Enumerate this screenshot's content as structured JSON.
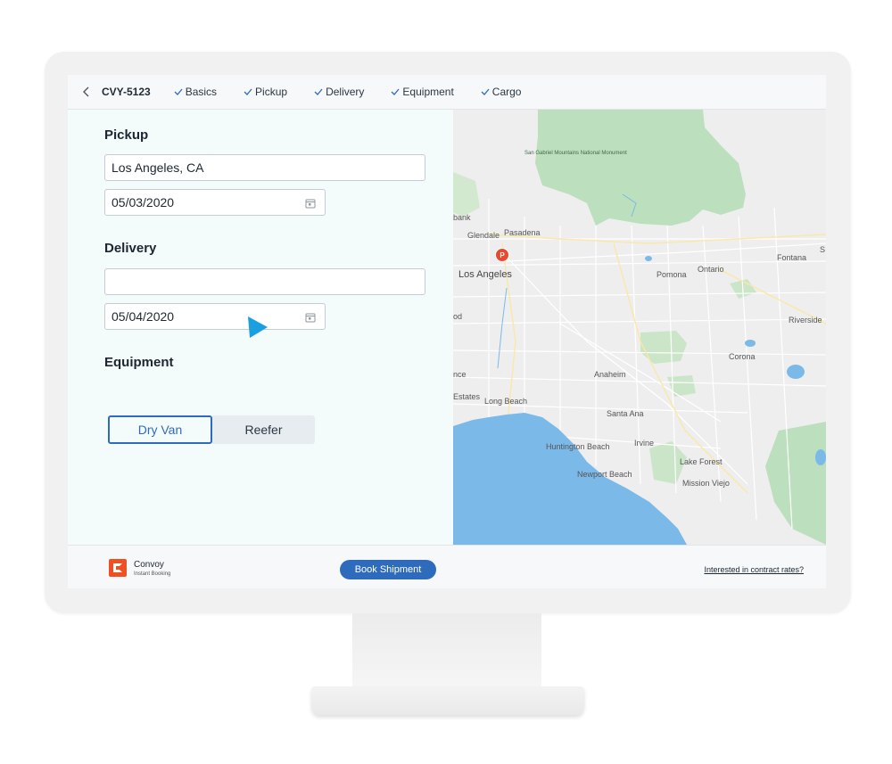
{
  "header": {
    "shipment_id": "CVY-5123",
    "steps": [
      {
        "label": "Basics"
      },
      {
        "label": "Pickup"
      },
      {
        "label": "Delivery"
      },
      {
        "label": "Equipment"
      },
      {
        "label": "Cargo"
      }
    ]
  },
  "form": {
    "pickup": {
      "label": "Pickup",
      "location_value": "Los Angeles, CA",
      "date_value": "05/03/2020"
    },
    "delivery": {
      "label": "Delivery",
      "location_value": "",
      "date_value": "05/04/2020"
    },
    "equipment": {
      "label": "Equipment",
      "options": [
        "Dry Van",
        "Reefer"
      ],
      "selected": "Dry Van"
    }
  },
  "map": {
    "pin_label": "P",
    "labels": {
      "monument": "San Gabriel Mountains National Monument",
      "burbank": "bank",
      "glendale": "Glendale",
      "pasadena": "Pasadena",
      "los_angeles": "Los Angeles",
      "hollywood": "od",
      "fontana": "Fontana",
      "ontario": "Ontario",
      "pomona": "Pomona",
      "riverside": "Riverside",
      "corona": "Corona",
      "anaheim": "Anaheim",
      "torrance": "nce",
      "estates": "Estates",
      "long_beach": "Long Beach",
      "santa_ana": "Santa Ana",
      "huntington_beach": "Huntington Beach",
      "irvine": "Irvine",
      "lake_forest": "Lake Forest",
      "newport_beach": "Newport Beach",
      "mission_viejo": "Mission Viejo",
      "edge_s": "S"
    },
    "colors": {
      "land": "#eeeeee",
      "water": "#7bb9e8",
      "park": "#b8dcb8"
    }
  },
  "footer": {
    "brand_name": "Convoy",
    "brand_sub": "Instant Booking",
    "book_label": "Book Shipment",
    "contract_link": "Interested in contract rates?"
  },
  "colors": {
    "accent": "#2f6bbd",
    "brand": "#f04e23",
    "form_bg": "#f3fcfb",
    "cursor": "#1a9fe0"
  }
}
